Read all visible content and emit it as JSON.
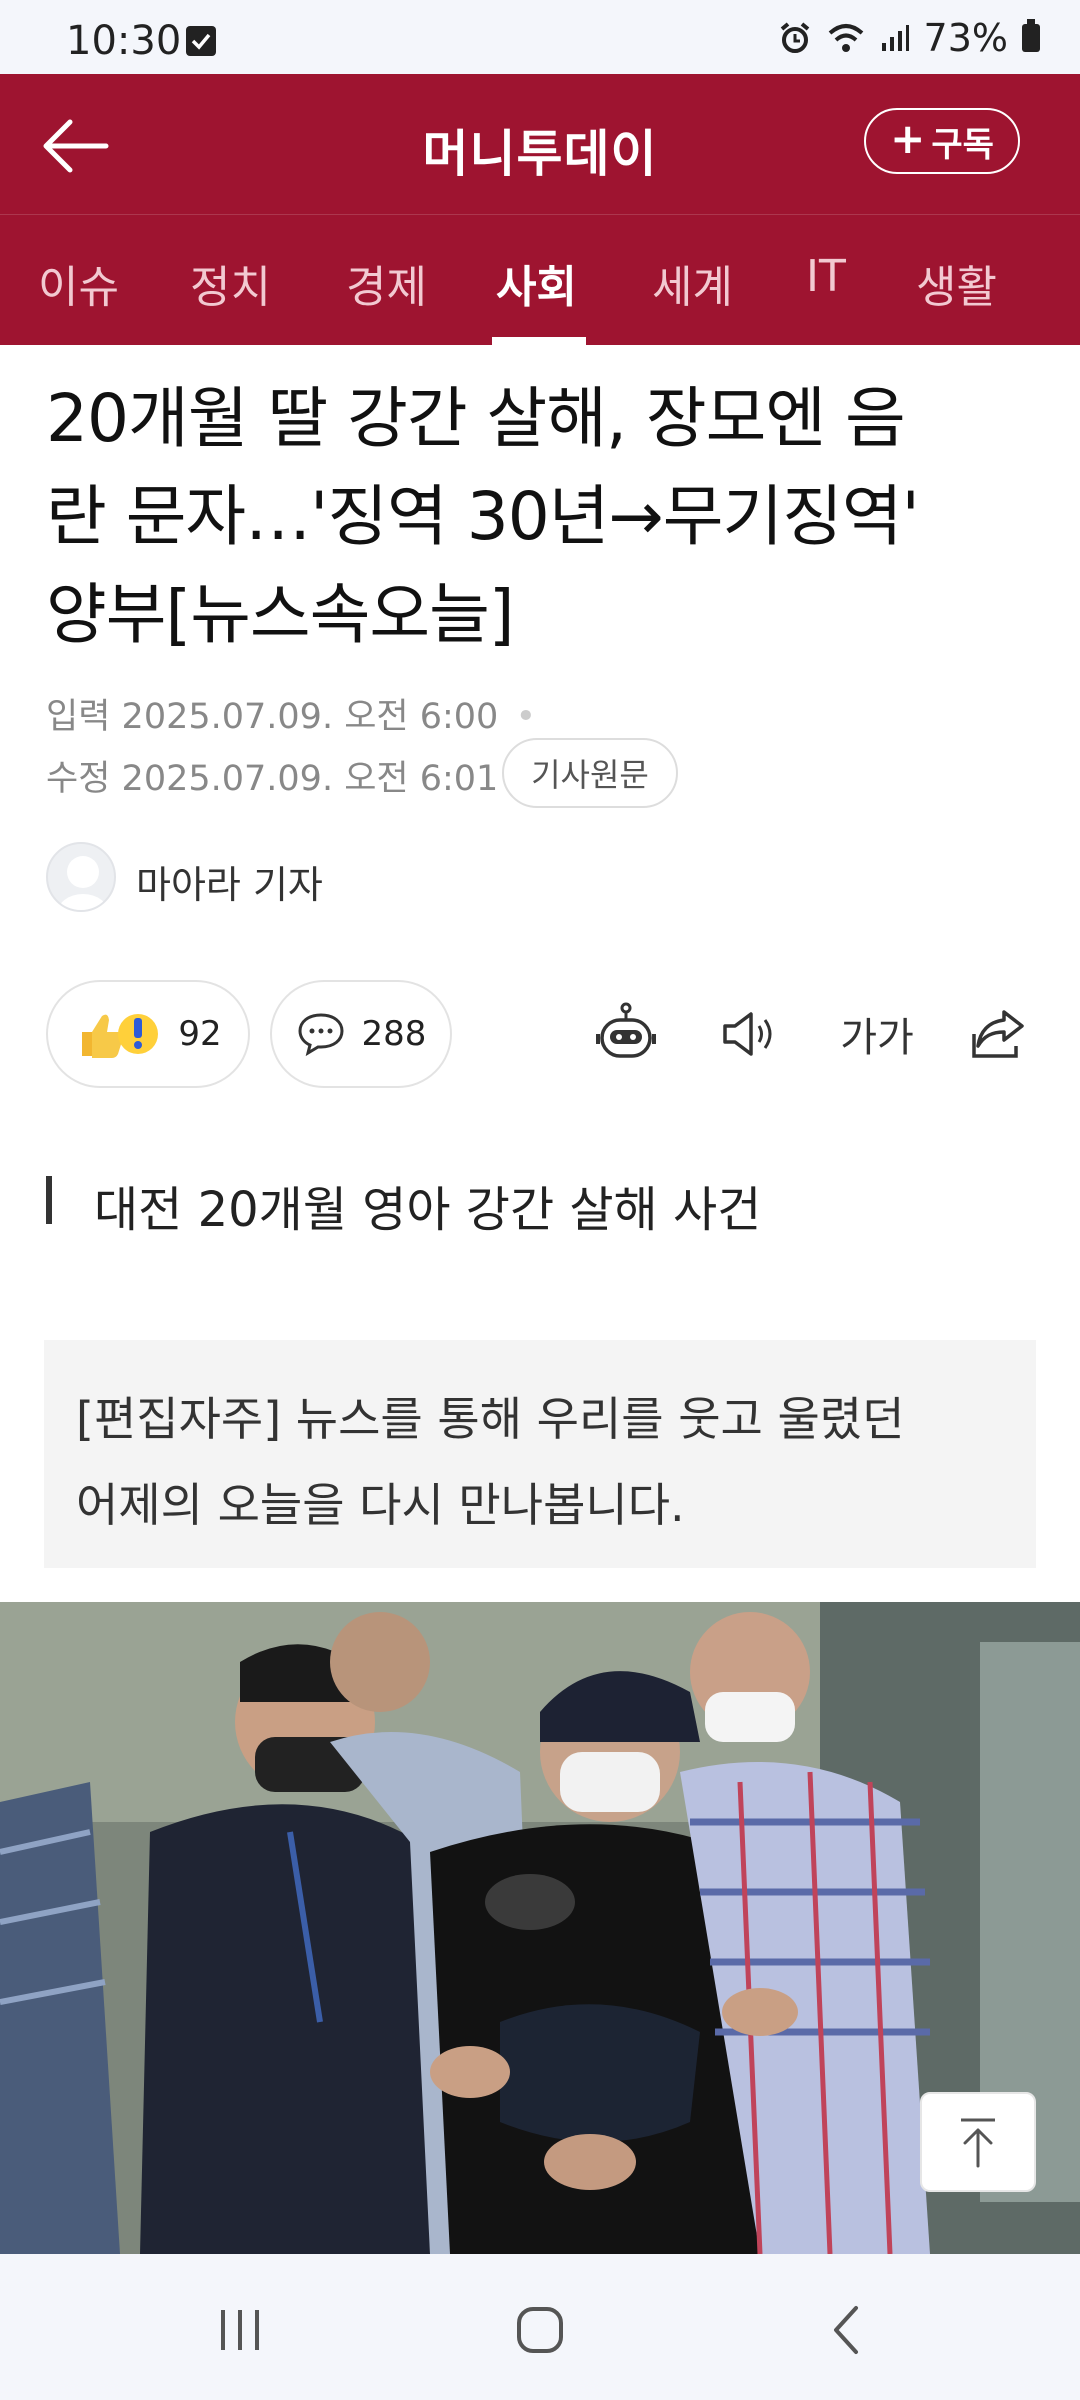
{
  "status_bar": {
    "time": "10:30",
    "battery": "73%"
  },
  "app_bar": {
    "title": "머니투데이",
    "subscribe_label": "구독"
  },
  "tabs": [
    {
      "label": "이슈"
    },
    {
      "label": "정치"
    },
    {
      "label": "경제"
    },
    {
      "label": "사회",
      "active": true
    },
    {
      "label": "세계"
    },
    {
      "label": "IT"
    },
    {
      "label": "생활"
    }
  ],
  "article": {
    "headline_lines": [
      "20개월 딸 강간 살해, 장모엔 음",
      "란 문자…'징역 30년→무기징역'",
      "양부[뉴스속오늘]"
    ],
    "input_label": "입력",
    "input_time": "2025.07.09. 오전 6:00",
    "modified_label": "수정",
    "modified_time": "2025.07.09. 오전 6:01",
    "original_label": "기사원문",
    "reporter": "마아라 기자",
    "like_count": "92",
    "comment_count": "288",
    "font_size_label": "가가",
    "section_title": "대전 20개월 영아 강간 살해 사건",
    "editor_note_lines": [
      "[편집자주] 뉴스를 통해 우리를 웃고 울렸던",
      "어제의 오늘을 다시 만나봅니다."
    ]
  },
  "colors": {
    "brand": "#9e1430",
    "tab_inactive": "#f2c9d1"
  }
}
